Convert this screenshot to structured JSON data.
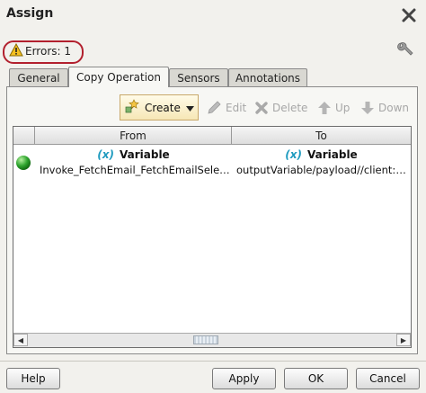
{
  "dialog": {
    "title": "Assign"
  },
  "status": {
    "errors_label": "Errors: 1"
  },
  "tabs": [
    {
      "label": "General"
    },
    {
      "label": "Copy Operation"
    },
    {
      "label": "Sensors"
    },
    {
      "label": "Annotations"
    }
  ],
  "toolbar": {
    "create_label": "Create",
    "edit_label": "Edit",
    "delete_label": "Delete",
    "up_label": "Up",
    "down_label": "Down"
  },
  "table": {
    "columns": [
      "From",
      "To"
    ],
    "rows": [
      {
        "from_type_prefix": "(x)",
        "from_type": "Variable",
        "from_path": "Invoke_FetchEmail_FetchEmailSele…",
        "to_type_prefix": "(x)",
        "to_type": "Variable",
        "to_path": "outputVariable/payload//client:Dat…",
        "status_color": "#2fa52f"
      }
    ]
  },
  "buttons": {
    "help_label": "Help",
    "apply_label": "Apply",
    "ok_label": "OK",
    "cancel_label": "Cancel"
  },
  "colors": {
    "error_outline": "#b2202e",
    "variable_accent": "#1f9bbf"
  }
}
